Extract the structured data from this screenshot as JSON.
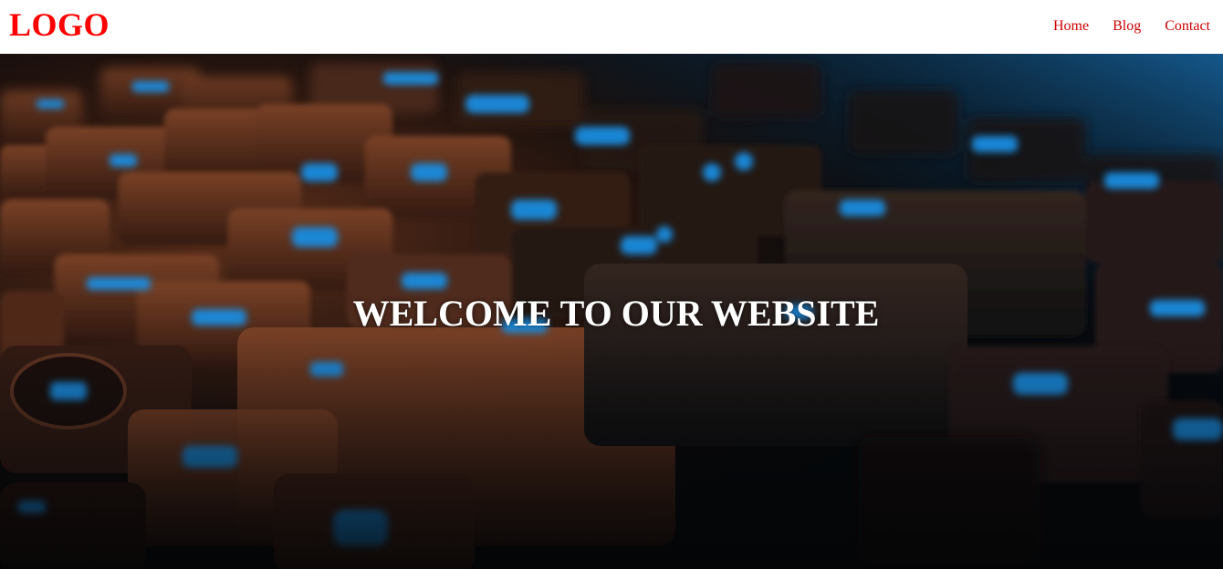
{
  "brand": {
    "logo_text": "LOGO",
    "accent_color": "#ff0000"
  },
  "nav": {
    "items": [
      {
        "label": "Home"
      },
      {
        "label": "Blog"
      },
      {
        "label": "Contact"
      }
    ],
    "link_color": "#cc0000"
  },
  "hero": {
    "title": "WELCOME TO OUR WEBSITE",
    "background_icon": "backlit-keyboard-photo"
  }
}
